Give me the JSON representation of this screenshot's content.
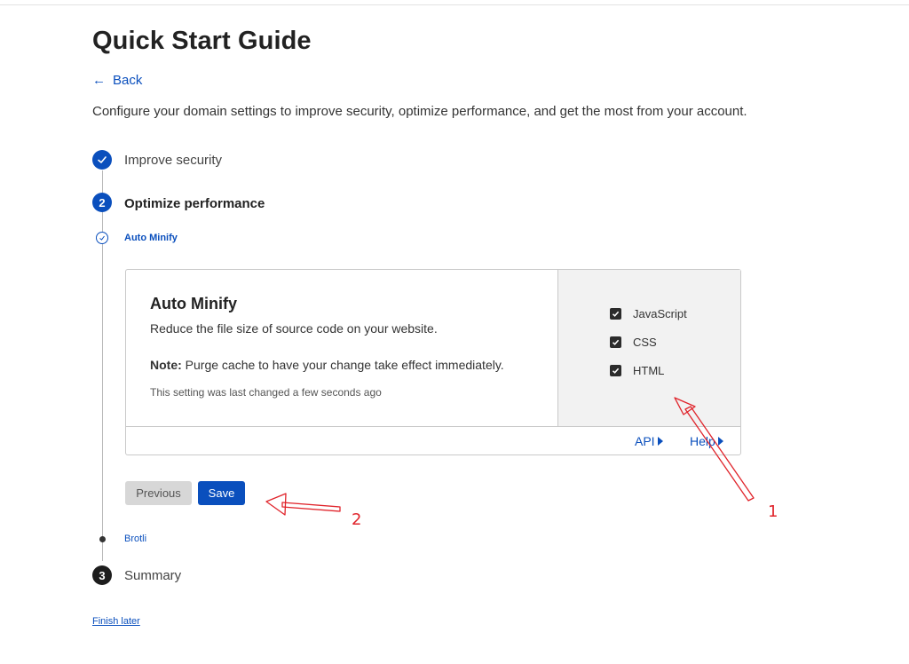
{
  "page": {
    "title": "Quick Start Guide",
    "back_label": "Back",
    "intro": "Configure your domain settings to improve security, optimize performance, and get the most from your account."
  },
  "steps": [
    {
      "number": "",
      "label": "Improve security",
      "status": "completed"
    },
    {
      "number": "2",
      "label": "Optimize performance",
      "status": "current"
    },
    {
      "number": "3",
      "label": "Summary",
      "status": "upcoming"
    }
  ],
  "substeps": {
    "current": "Auto Minify",
    "next": "Brotli"
  },
  "card": {
    "title": "Auto Minify",
    "description": "Reduce the file size of source code on your website.",
    "note_label": "Note:",
    "note_text": " Purge cache to have your change take effect immediately.",
    "last_changed": "This setting was last changed a few seconds ago",
    "options": [
      {
        "label": "JavaScript",
        "checked": true
      },
      {
        "label": "CSS",
        "checked": true
      },
      {
        "label": "HTML",
        "checked": true
      }
    ],
    "footer_links": {
      "api": "API",
      "help": "Help"
    }
  },
  "buttons": {
    "previous": "Previous",
    "save": "Save"
  },
  "finish_later": "Finish later",
  "annotations": {
    "marker_1": "1",
    "marker_2": "2",
    "color": "#e0242b"
  },
  "colors": {
    "accent": "#0a4fbd",
    "dark": "#1d1d1d"
  }
}
